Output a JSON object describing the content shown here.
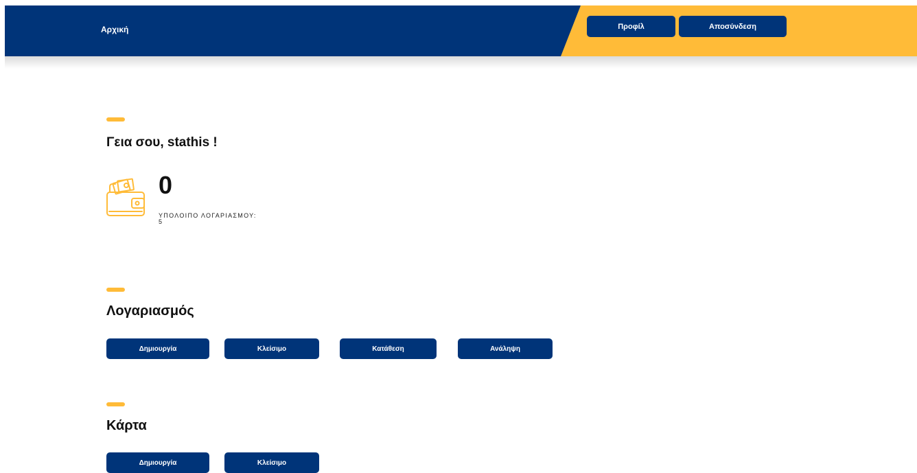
{
  "header": {
    "home_label": "Αρχική",
    "profile_label": "Προφίλ",
    "logout_label": "Αποσύνδεση"
  },
  "welcome": {
    "greeting": "Γεια σου, stathis !",
    "balance_value": "0",
    "balance_label": "Υπολοιπο λογαριασμου: 5",
    "icon": "wallet-icon"
  },
  "account": {
    "title": "Λογαριασμός",
    "buttons": [
      "Δημιουργία",
      "Κλείσιμο",
      "Κατάθεση",
      "Ανάληψη"
    ]
  },
  "card": {
    "title": "Κάρτα",
    "buttons": [
      "Δημιουργία",
      "Κλείσιμο"
    ]
  },
  "colors": {
    "primary": "#003479",
    "accent": "#ffbb38",
    "background": "#ffffff"
  }
}
